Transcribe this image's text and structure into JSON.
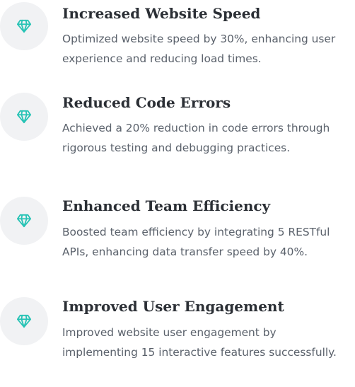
{
  "accent_color": "#27c3b5",
  "icon_background_color": "#f1f2f4",
  "achievements": [
    {
      "icon": "diamond-icon",
      "title": "Increased Website Speed",
      "description": "Optimized website speed by 30%, enhancing user experience and reducing load times."
    },
    {
      "icon": "diamond-icon",
      "title": "Reduced Code Errors",
      "description": "Achieved a 20% reduction in code errors through rigorous testing and debugging practices."
    },
    {
      "icon": "diamond-icon",
      "title": "Enhanced Team Efficiency",
      "description": "Boosted team efficiency by integrating 5 RESTful APIs, enhancing data transfer speed by 40%."
    },
    {
      "icon": "diamond-icon",
      "title": "Improved User Engagement",
      "description": "Improved website user engagement by implementing 15 interactive features successfully."
    }
  ]
}
